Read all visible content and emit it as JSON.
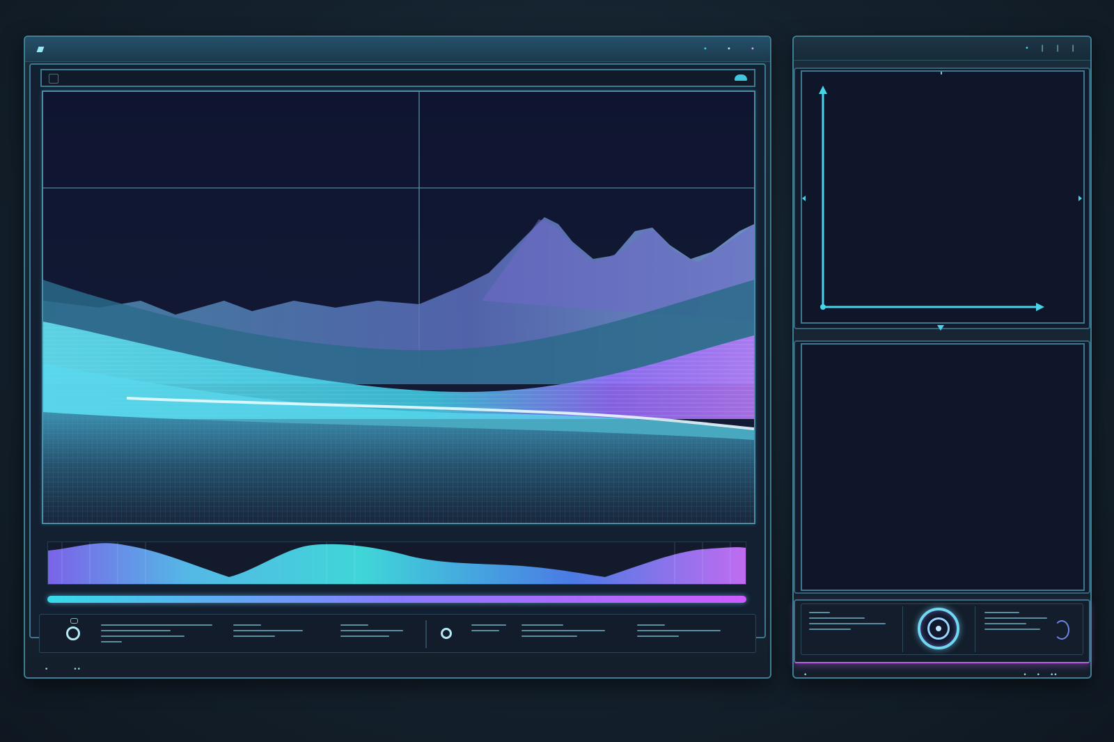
{
  "main_window": {
    "title": "",
    "controls": [
      "•",
      "•",
      "•"
    ],
    "viewport_icon_left": "file-icon",
    "viewport_icon_right": "cloud-icon",
    "progress": 1.0,
    "progress_gradient": [
      "#35dbe8",
      "#8a7bff",
      "#cf5bff"
    ],
    "footer_left": [
      "•",
      "••"
    ]
  },
  "side_window": {
    "title": "",
    "controls": [
      "•",
      "|",
      "|",
      "|"
    ],
    "footer": [
      "•",
      "•",
      "•",
      "••"
    ]
  },
  "colors": {
    "accent_cyan": "#49d4ea",
    "accent_violet": "#a86bff",
    "accent_magenta": "#d65cff",
    "panel_border": "#3e7f94",
    "screen_bg": "#0f1629"
  },
  "icons": [
    "file-icon",
    "cloud-icon",
    "record-ring-icon",
    "axis-arrow-icon",
    "knob-icon",
    "toggle-icon"
  ]
}
